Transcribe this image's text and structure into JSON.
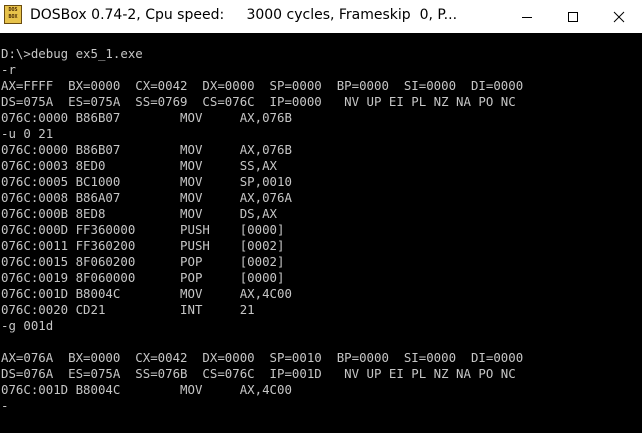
{
  "window": {
    "title": "DOSBox 0.74-2, Cpu speed:     3000 cycles, Frameskip  0, P...",
    "icon_label_top": "DOS",
    "icon_label_bottom": "BOX"
  },
  "console": {
    "lines": [
      "D:\\>debug ex5_1.exe",
      "-r",
      "AX=FFFF  BX=0000  CX=0042  DX=0000  SP=0000  BP=0000  SI=0000  DI=0000",
      "DS=075A  ES=075A  SS=0769  CS=076C  IP=0000   NV UP EI PL NZ NA PO NC",
      "076C:0000 B86B07        MOV     AX,076B",
      "-u 0 21",
      "076C:0000 B86B07        MOV     AX,076B",
      "076C:0003 8ED0          MOV     SS,AX",
      "076C:0005 BC1000        MOV     SP,0010",
      "076C:0008 B86A07        MOV     AX,076A",
      "076C:000B 8ED8          MOV     DS,AX",
      "076C:000D FF360000      PUSH    [0000]",
      "076C:0011 FF360200      PUSH    [0002]",
      "076C:0015 8F060200      POP     [0002]",
      "076C:0019 8F060000      POP     [0000]",
      "076C:001D B8004C        MOV     AX,4C00",
      "076C:0020 CD21          INT     21",
      "-g 001d",
      "",
      "AX=076A  BX=0000  CX=0042  DX=0000  SP=0010  BP=0000  SI=0000  DI=0000",
      "DS=076A  ES=075A  SS=076B  CS=076C  IP=001D   NV UP EI PL NZ NA PO NC",
      "076C:001D B8004C        MOV     AX,4C00",
      "-"
    ]
  },
  "colors": {
    "titlebar_bg": "#ffffff",
    "console_bg": "#000000",
    "console_text": "#c6c6c6"
  }
}
